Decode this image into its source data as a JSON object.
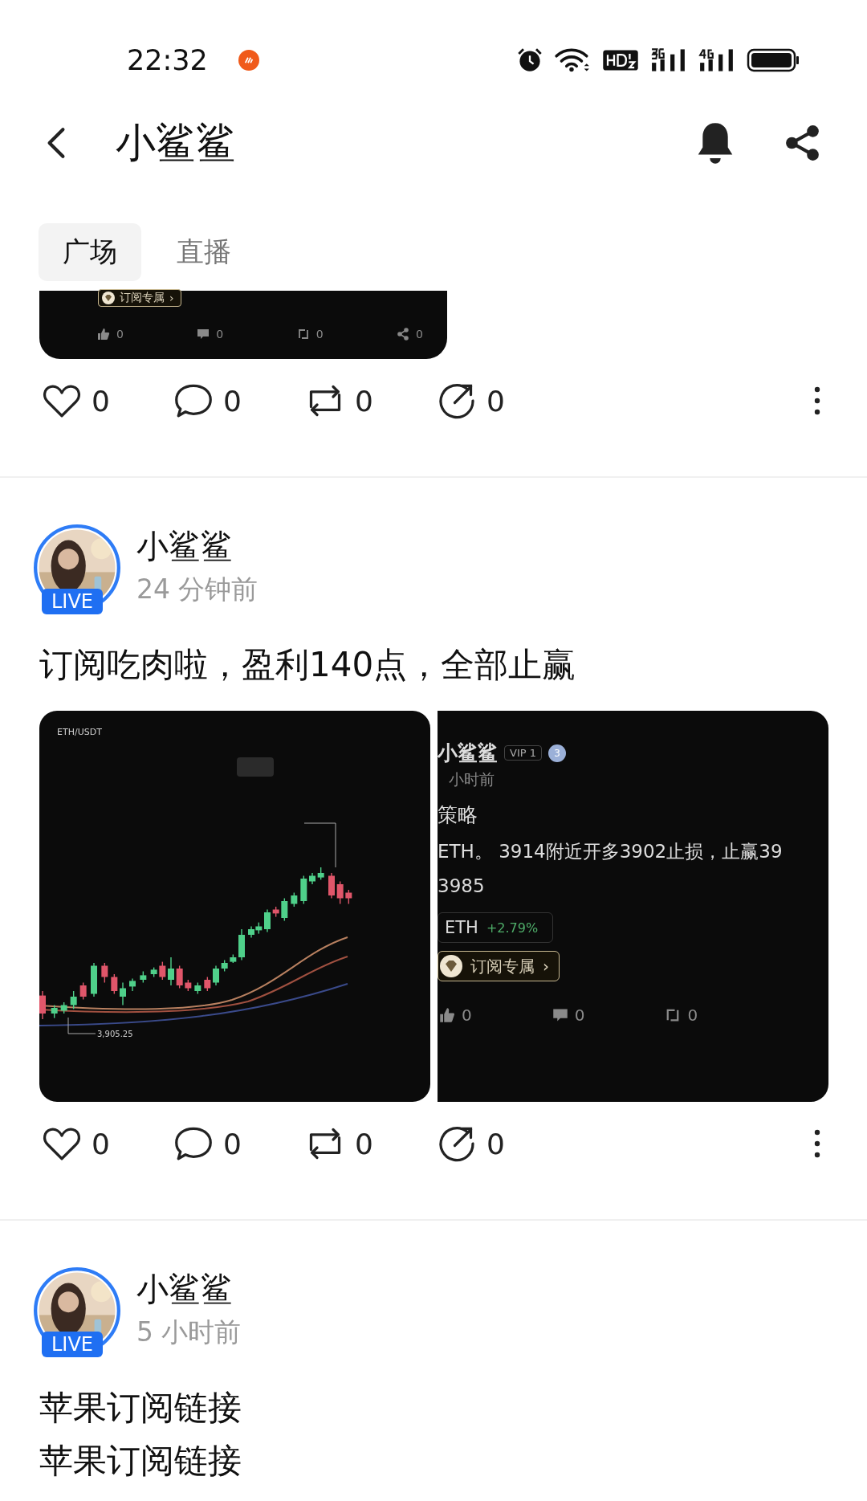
{
  "status_bar": {
    "time": "22:32"
  },
  "header": {
    "title": "小鲨鲨"
  },
  "tabs": [
    {
      "label": "广场",
      "selected": true
    },
    {
      "label": "直播",
      "selected": false
    }
  ],
  "partial_post": {
    "embed": {
      "badge": "订阅专属",
      "chevron": "›",
      "stats": [
        {
          "kind": "like",
          "count": "0"
        },
        {
          "kind": "comment",
          "count": "0"
        },
        {
          "kind": "repost",
          "count": "0"
        },
        {
          "kind": "share",
          "count": "0"
        }
      ]
    },
    "actions": [
      {
        "kind": "like",
        "count": "0"
      },
      {
        "kind": "comment",
        "count": "0"
      },
      {
        "kind": "repost",
        "count": "0"
      },
      {
        "kind": "share",
        "count": "0"
      }
    ]
  },
  "posts": [
    {
      "author": "小鲨鲨",
      "live_badge": "LIVE",
      "time": "24 分钟前",
      "lines": [
        "订阅吃肉啦，盈利140点，全部止赢"
      ],
      "images": [
        {
          "kind": "chart_screenshot",
          "pair": "ETH/USDT",
          "low_label": "3,905.25"
        },
        {
          "kind": "post_screenshot",
          "author": "小鲨鲨",
          "vip": "VIP 1",
          "rank": "3",
          "time": "小时前",
          "title": "策略",
          "body": [
            "ETH。 3914附近开多3902止损，止赢39",
            "3985"
          ],
          "ticker": "ETH",
          "change": "+2.79%",
          "badge": "订阅专属",
          "chevron": "›",
          "stats": [
            {
              "kind": "like",
              "count": "0"
            },
            {
              "kind": "comment",
              "count": "0"
            },
            {
              "kind": "repost",
              "count": "0"
            }
          ]
        }
      ],
      "actions": [
        {
          "kind": "like",
          "count": "0"
        },
        {
          "kind": "comment",
          "count": "0"
        },
        {
          "kind": "repost",
          "count": "0"
        },
        {
          "kind": "share",
          "count": "0"
        }
      ]
    },
    {
      "author": "小鲨鲨",
      "live_badge": "LIVE",
      "time": "5 小时前",
      "lines": [
        "苹果订阅链接",
        "苹果订阅链接"
      ]
    }
  ]
}
